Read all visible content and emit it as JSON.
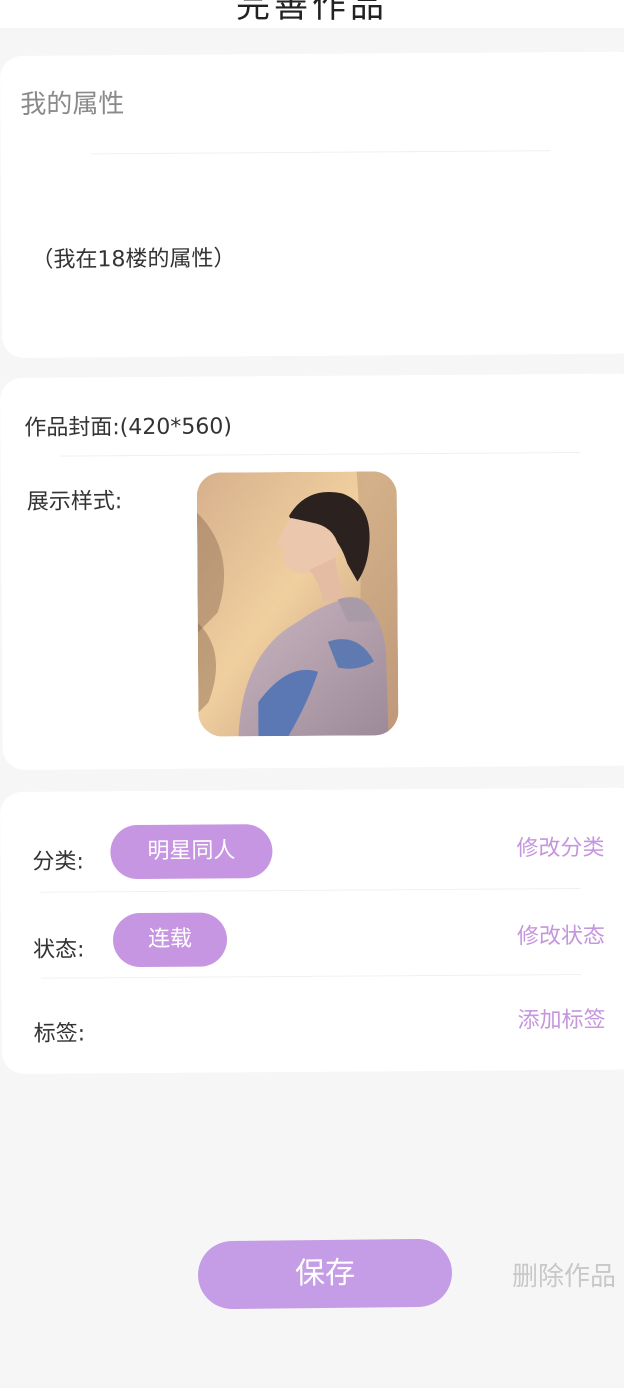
{
  "header": {
    "title": "完善作品"
  },
  "attributes": {
    "title": "我的属性",
    "content": "（我在18楼的属性）"
  },
  "cover": {
    "label": "作品封面:(420*560)",
    "style_label": "展示样式:"
  },
  "meta": {
    "category_label": "分类:",
    "category_value": "明星同人",
    "category_action": "修改分类",
    "status_label": "状态:",
    "status_value": "连载",
    "status_action": "修改状态",
    "tags_label": "标签:",
    "tags_action": "添加标签"
  },
  "actions": {
    "save": "保存",
    "delete": "删除作品"
  },
  "colors": {
    "accent": "#c796e3",
    "accent_text": "#c596dd",
    "background": "#f6f6f6"
  }
}
